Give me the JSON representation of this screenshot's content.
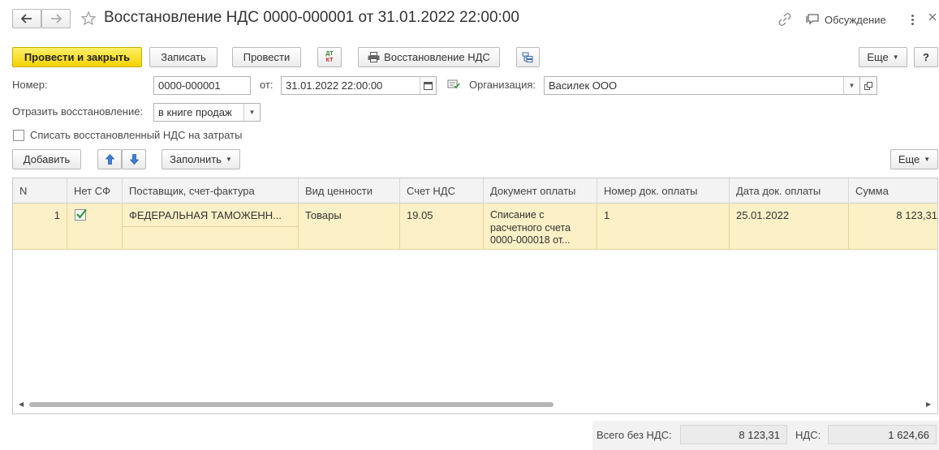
{
  "header": {
    "title": "Восстановление НДС 0000-000001 от 31.01.2022 22:00:00",
    "discussion_label": "Обсуждение",
    "back_icon": "arrow-left-icon",
    "forward_icon": "arrow-right-icon",
    "favorite_icon": "star-icon",
    "link_icon": "link-icon",
    "discussion_icon": "chat-icon",
    "menu_icon": "more-vertical-icon",
    "close_icon": "close-icon"
  },
  "toolbar": {
    "post_close_label": "Провести и закрыть",
    "save_label": "Записать",
    "post_label": "Провести",
    "dtkt_top": "ДТ",
    "dtkt_bottom": "КТ",
    "print_label": "Восстановление НДС",
    "more_label": "Еще",
    "help_label": "?"
  },
  "form": {
    "number_label": "Номер:",
    "number_value": "0000-000001",
    "date_label": "от:",
    "date_value": "31.01.2022 22:00:00",
    "org_label": "Организация:",
    "org_value": "Василек ООО",
    "reflect_label": "Отразить восстановление:",
    "reflect_value": "в книге продаж",
    "writeoff_label": "Списать восстановленный НДС на затраты"
  },
  "table_toolbar": {
    "add_label": "Добавить",
    "fill_label": "Заполнить",
    "more_label": "Еще"
  },
  "table": {
    "columns": [
      "N",
      "Нет СФ",
      "Поставщик, счет-фактура",
      "Вид ценности",
      "Счет НДС",
      "Документ оплаты",
      "Номер док. оплаты",
      "Дата док. оплаты",
      "Сумма"
    ],
    "rows": [
      {
        "n": "1",
        "no_invoice": true,
        "supplier": "ФЕДЕРАЛЬНАЯ ТАМОЖЕНН...",
        "value_type": "Товары",
        "vat_account": "19.05",
        "payment_doc_line1": "Списание с",
        "payment_doc_line2": "расчетного счета",
        "payment_doc_line3": "0000-000018 от...",
        "payment_number": "1",
        "payment_date": "25.01.2022",
        "amount": "8 123,31"
      }
    ]
  },
  "totals": {
    "without_vat_label": "Всего без НДС:",
    "without_vat_value": "8 123,31",
    "vat_label": "НДС:",
    "vat_value": "1 624,66"
  },
  "colors": {
    "primary_button": "#f5d200",
    "selected_row": "#fbf0c6",
    "checkmark": "#2e9a3a",
    "arrow_blue": "#3d7fd6"
  }
}
